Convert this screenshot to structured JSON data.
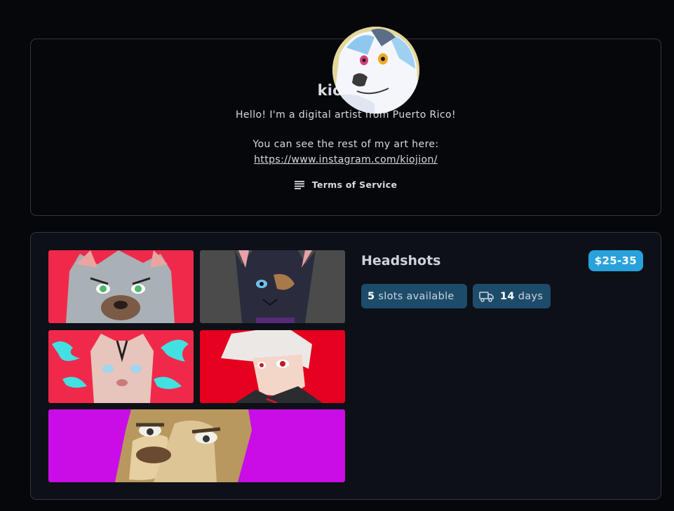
{
  "profile": {
    "username": "kiojion",
    "bio": "Hello! I'm a digital artist from Puerto Rico!",
    "bio_line2": "You can see the rest of my art here:",
    "link": "https://www.instagram.com/kiojion/",
    "tos_label": "Terms of Service",
    "tos_icon": "list-icon"
  },
  "commission": {
    "title": "Headshots",
    "price": "$25-35",
    "slots_count": "5",
    "slots_label": "slots available",
    "days_count": "14",
    "days_label": "days",
    "delivery_icon": "truck-icon",
    "gallery_backgrounds": [
      "#f0294b",
      "#4b4b4b",
      "#f0294b",
      "#e5001f",
      "#c90de6"
    ]
  },
  "colors": {
    "page_bg": "#05070b",
    "card_border": "#33373f",
    "price_badge": "#28a1dd",
    "pill_bg": "#1d4c6a"
  }
}
